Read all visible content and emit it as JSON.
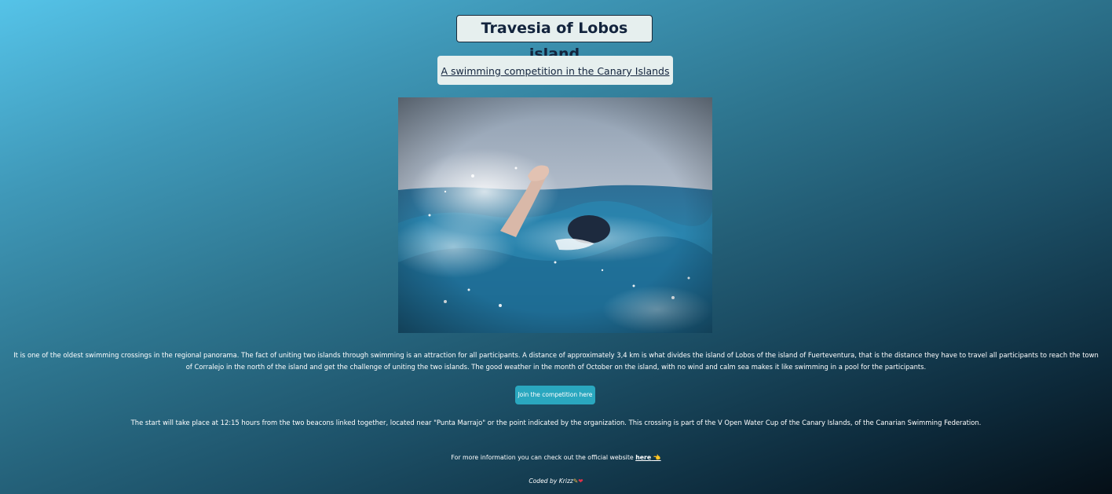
{
  "header": {
    "title": "Travesia of Lobos island",
    "subtitle_link": "A swimming competition in the Canary Islands"
  },
  "hero": {
    "alt": "Swimmer doing front crawl in the sea"
  },
  "content": {
    "description": "It is one of the oldest swimming crossings in the regional panorama. The fact of uniting two islands through swimming is an attraction for all participants. A distance of approximately 3,4 km is what divides the island of Lobos of the island of Fuerteventura, that is the distance they have to travel all participants to reach the town of Corralejo in the north of the island and get the challenge of uniting the two islands. The good weather in the month of October on the island, with no wind and calm sea makes it like swimming in a pool for the participants.",
    "join_button": "Join the competition here",
    "start_info": "The start will take place at 12:15 hours from the two beacons linked together, located near \"Punta Marrajo\" or the point indicated by the organization. This crossing is part of the V Open Water Cup of the Canary Islands, of the Canarian Swimming Federation.",
    "more_info_prefix": "For more information you can check out the official website ",
    "more_info_link": "here",
    "more_info_link_icon": "👈"
  },
  "footer": {
    "credit": "Coded by Krizz",
    "credit_icons": [
      "pencil-icon",
      "heart-icon"
    ]
  }
}
